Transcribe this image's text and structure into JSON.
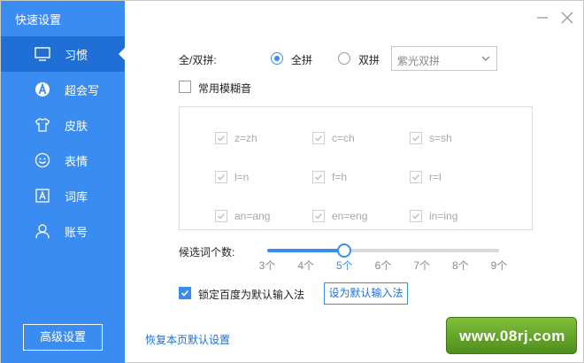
{
  "window": {
    "title": "快速设置"
  },
  "sidebar": {
    "items": [
      {
        "label": "习惯",
        "icon": "monitor-icon",
        "active": true
      },
      {
        "label": "超会写",
        "icon": "pen-a-icon",
        "active": false
      },
      {
        "label": "皮肤",
        "icon": "tshirt-icon",
        "active": false
      },
      {
        "label": "表情",
        "icon": "smiley-icon",
        "active": false
      },
      {
        "label": "词库",
        "icon": "lexicon-a-icon",
        "active": false
      },
      {
        "label": "账号",
        "icon": "user-icon",
        "active": false
      }
    ],
    "advanced_button": "高级设置"
  },
  "controls": {
    "minimize": "minimize-icon",
    "close": "close-icon"
  },
  "pinyin": {
    "label": "全/双拼:",
    "options": [
      {
        "label": "全拼",
        "selected": true
      },
      {
        "label": "双拼",
        "selected": false
      }
    ],
    "scheme_select": "紫光双拼"
  },
  "fuzzy": {
    "label": "常用模糊音",
    "enabled": false,
    "pairs": [
      "z=zh",
      "c=ch",
      "s=sh",
      "l=n",
      "f=h",
      "r=l",
      "an=ang",
      "en=eng",
      "in=ing"
    ]
  },
  "candidates": {
    "label": "候选词个数:",
    "ticks": [
      "3个",
      "4个",
      "5个",
      "6个",
      "7个",
      "8个",
      "9个"
    ],
    "value": 5,
    "min": 3,
    "max": 9
  },
  "default_ime": {
    "lock_label": "锁定百度为默认输入法",
    "locked": true,
    "set_default_button": "设为默认输入法"
  },
  "restore_link": "恢复本页默认设置",
  "watermark": "www.08rj.com",
  "colors": {
    "accent": "#3b8cf0",
    "sidebar_active": "#1f6fd6",
    "watermark_green": "#5e9d24"
  }
}
